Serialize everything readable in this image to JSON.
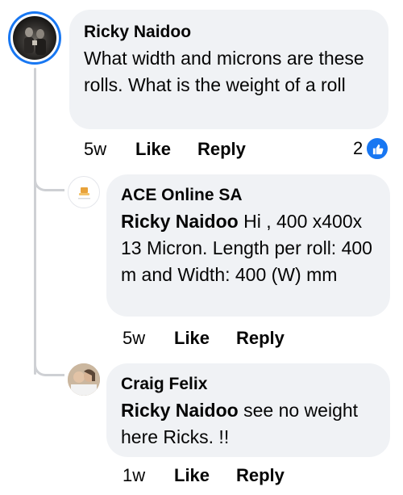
{
  "comments": [
    {
      "author": "Ricky Naidoo",
      "text": "What width and microns are these rolls. What is the weight of a roll",
      "time": "5w",
      "like_label": "Like",
      "reply_label": "Reply",
      "reaction_count": "2"
    },
    {
      "author": "ACE Online SA",
      "mention": "Ricky Naidoo",
      "text": " Hi , 400 x400x 13 Micron. Length per roll: 400 m and Width: 400 (W) mm",
      "time": "5w",
      "like_label": "Like",
      "reply_label": "Reply"
    },
    {
      "author": "Craig Felix",
      "mention": "Ricky Naidoo",
      "text": " see no weight here Ricks. !!",
      "time": "1w",
      "like_label": "Like",
      "reply_label": "Reply"
    }
  ],
  "colors": {
    "bubble": "#f0f2f5",
    "accent": "#1877f2",
    "thread_line": "#ced0d4"
  },
  "icons": [
    "like-thumb-icon"
  ]
}
